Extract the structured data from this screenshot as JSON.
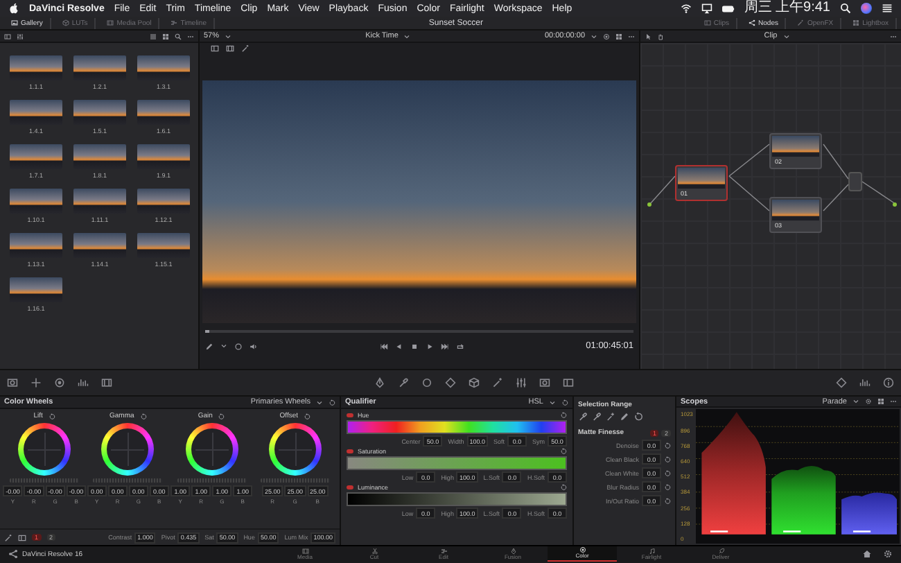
{
  "menu_bar": {
    "app_name": "DaVinci Resolve",
    "menus": [
      "File",
      "Edit",
      "Trim",
      "Timeline",
      "Clip",
      "Mark",
      "View",
      "Playback",
      "Fusion",
      "Color",
      "Fairlight",
      "Workspace",
      "Help"
    ],
    "clock": "周三 上午9:41"
  },
  "top_bar": {
    "left_tabs": [
      {
        "label": "Gallery",
        "selected": true
      },
      {
        "label": "LUTs",
        "selected": false
      },
      {
        "label": "Media Pool",
        "selected": false
      },
      {
        "label": "Timeline",
        "selected": false
      }
    ],
    "title": "Sunset Soccer",
    "right_tabs": [
      {
        "label": "Clips",
        "selected": false
      },
      {
        "label": "Nodes",
        "selected": true
      },
      {
        "label": "OpenFX",
        "selected": false
      },
      {
        "label": "Lightbox",
        "selected": false
      }
    ]
  },
  "gallery": {
    "stills": [
      {
        "label": "1.1.1"
      },
      {
        "label": "1.2.1"
      },
      {
        "label": "1.3.1"
      },
      {
        "label": "1.4.1"
      },
      {
        "label": "1.5.1"
      },
      {
        "label": "1.6.1"
      },
      {
        "label": "1.7.1"
      },
      {
        "label": "1.8.1"
      },
      {
        "label": "1.9.1"
      },
      {
        "label": "1.10.1"
      },
      {
        "label": "1.11.1"
      },
      {
        "label": "1.12.1"
      },
      {
        "label": "1.13.1"
      },
      {
        "label": "1.14.1"
      },
      {
        "label": "1.15.1"
      },
      {
        "label": "1.16.1"
      }
    ]
  },
  "viewer": {
    "zoom": "57%",
    "clip_name": "Kick Time",
    "source_timecode": "00:00:00:00",
    "timecode": "01:00:45:01"
  },
  "node_editor": {
    "mode": "Clip",
    "nodes": [
      {
        "label": "01",
        "selected": true
      },
      {
        "label": "02",
        "selected": false
      },
      {
        "label": "03",
        "selected": false
      }
    ]
  },
  "color_wheels": {
    "title": "Color Wheels",
    "mode": "Primaries Wheels",
    "wheels": [
      {
        "name": "Lift",
        "values": [
          {
            "channel": "Y",
            "value": "-0.00"
          },
          {
            "channel": "R",
            "value": "-0.00"
          },
          {
            "channel": "G",
            "value": "-0.00"
          },
          {
            "channel": "B",
            "value": "-0.00"
          }
        ]
      },
      {
        "name": "Gamma",
        "values": [
          {
            "channel": "Y",
            "value": "0.00"
          },
          {
            "channel": "R",
            "value": "0.00"
          },
          {
            "channel": "G",
            "value": "0.00"
          },
          {
            "channel": "B",
            "value": "0.00"
          }
        ]
      },
      {
        "name": "Gain",
        "values": [
          {
            "channel": "Y",
            "value": "1.00"
          },
          {
            "channel": "R",
            "value": "1.00"
          },
          {
            "channel": "G",
            "value": "1.00"
          },
          {
            "channel": "B",
            "value": "1.00"
          }
        ]
      },
      {
        "name": "Offset",
        "values": [
          {
            "channel": "R",
            "value": "25.00"
          },
          {
            "channel": "G",
            "value": "25.00"
          },
          {
            "channel": "B",
            "value": "25.00"
          }
        ]
      }
    ],
    "tabs": [
      {
        "label": "1",
        "selected": true
      },
      {
        "label": "2",
        "selected": false
      }
    ],
    "adjustments": [
      {
        "label": "Contrast",
        "value": "1.000"
      },
      {
        "label": "Pivot",
        "value": "0.435"
      },
      {
        "label": "Sat",
        "value": "50.00"
      },
      {
        "label": "Hue",
        "value": "50.00"
      },
      {
        "label": "Lum Mix",
        "value": "100.00"
      }
    ]
  },
  "qualifier": {
    "title": "Qualifier",
    "mode": "HSL",
    "channels": [
      {
        "name": "Hue",
        "kind": "hue",
        "on": true,
        "fields": [
          {
            "label": "Center",
            "value": "50.0"
          },
          {
            "label": "Width",
            "value": "100.0"
          },
          {
            "label": "Soft",
            "value": "0.0"
          },
          {
            "label": "Sym",
            "value": "50.0"
          }
        ]
      },
      {
        "name": "Saturation",
        "kind": "saturation",
        "on": true,
        "fields": [
          {
            "label": "Low",
            "value": "0.0"
          },
          {
            "label": "High",
            "value": "100.0"
          },
          {
            "label": "L.Soft",
            "value": "0.0"
          },
          {
            "label": "H.Soft",
            "value": "0.0"
          }
        ]
      },
      {
        "name": "Luminance",
        "kind": "luminance",
        "on": true,
        "fields": [
          {
            "label": "Low",
            "value": "0.0"
          },
          {
            "label": "High",
            "value": "100.0"
          },
          {
            "label": "L.Soft",
            "value": "0.0"
          },
          {
            "label": "H.Soft",
            "value": "0.0"
          }
        ]
      }
    ]
  },
  "selection_range": {
    "title": "Selection Range"
  },
  "matte_finesse": {
    "title": "Matte Finesse",
    "tabs": [
      {
        "label": "1",
        "selected": true
      },
      {
        "label": "2",
        "selected": false
      }
    ],
    "fields": [
      {
        "label": "Denoise",
        "value": "0.0"
      },
      {
        "label": "Clean Black",
        "value": "0.0"
      },
      {
        "label": "Clean White",
        "value": "0.0"
      },
      {
        "label": "Blur Radius",
        "value": "0.0"
      },
      {
        "label": "In/Out Ratio",
        "value": "0.0"
      }
    ]
  },
  "scopes": {
    "title": "Scopes",
    "mode": "Parade",
    "scale": [
      "1023",
      "896",
      "768",
      "640",
      "512",
      "384",
      "256",
      "128",
      "0"
    ]
  },
  "page_bar": {
    "app_name": "DaVinci Resolve 16",
    "pages": [
      {
        "label": "Media",
        "selected": false
      },
      {
        "label": "Cut",
        "selected": false
      },
      {
        "label": "Edit",
        "selected": false
      },
      {
        "label": "Fusion",
        "selected": false
      },
      {
        "label": "Color",
        "selected": true
      },
      {
        "label": "Fairlight",
        "selected": false
      },
      {
        "label": "Deliver",
        "selected": false
      }
    ]
  }
}
